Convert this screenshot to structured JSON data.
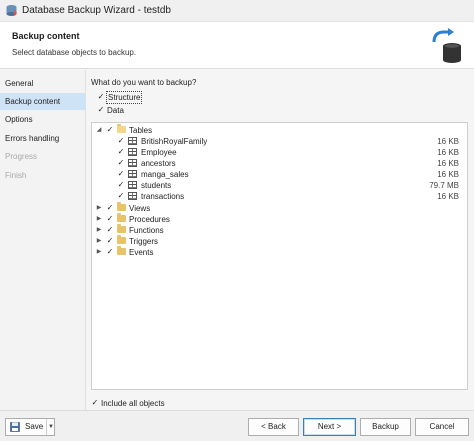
{
  "window": {
    "title": "Database Backup Wizard - testdb"
  },
  "header": {
    "title": "Backup content",
    "subtitle": "Select database objects to backup.",
    "icon": "database-backup-icon"
  },
  "sidebar": {
    "items": [
      {
        "label": "General",
        "state": "normal"
      },
      {
        "label": "Backup content",
        "state": "active"
      },
      {
        "label": "Options",
        "state": "normal"
      },
      {
        "label": "Errors handling",
        "state": "normal"
      },
      {
        "label": "Progress",
        "state": "disabled"
      },
      {
        "label": "Finish",
        "state": "disabled"
      }
    ]
  },
  "content": {
    "question": "What do you want to backup?",
    "structure_label": "Structure",
    "data_label": "Data",
    "include_all_label": "Include all objects",
    "tree": {
      "tables": {
        "label": "Tables",
        "items": [
          {
            "name": "BritishRoyalFamily",
            "size": "16 KB"
          },
          {
            "name": "Employee",
            "size": "16 KB"
          },
          {
            "name": "ancestors",
            "size": "16 KB"
          },
          {
            "name": "manga_sales",
            "size": "16 KB"
          },
          {
            "name": "students",
            "size": "79.7 MB"
          },
          {
            "name": "transactions",
            "size": "16 KB"
          }
        ]
      },
      "folders": [
        "Views",
        "Procedures",
        "Functions",
        "Triggers",
        "Events"
      ]
    }
  },
  "footer": {
    "save_label": "Save",
    "back_label": "< Back",
    "next_label": "Next >",
    "backup_label": "Backup",
    "cancel_label": "Cancel"
  },
  "colors": {
    "accent": "#3c7fb1",
    "active_nav": "#cfe3f7",
    "folder": "#e8c36a"
  }
}
